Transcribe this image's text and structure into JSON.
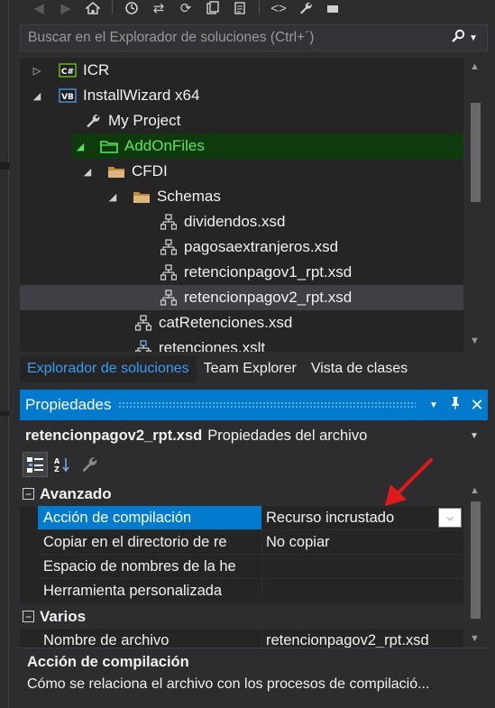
{
  "search": {
    "placeholder": "Buscar en el Explorador de soluciones (Ctrl+´)"
  },
  "tree": {
    "items": [
      {
        "label": "ICR",
        "icon": "csharp-project-icon",
        "expander": "collapsed"
      },
      {
        "label": "InstallWizard x64",
        "icon": "vb-project-icon",
        "expander": "expanded"
      },
      {
        "label": "My Project",
        "icon": "wrench-icon",
        "expander": "none"
      },
      {
        "label": "AddOnFiles",
        "icon": "folder-icon",
        "expander": "expanded"
      },
      {
        "label": "CFDI",
        "icon": "folder-icon",
        "expander": "expanded"
      },
      {
        "label": "Schemas",
        "icon": "folder-icon",
        "expander": "expanded"
      },
      {
        "label": "dividendos.xsd",
        "icon": "xsd-schema-icon",
        "expander": "none"
      },
      {
        "label": "pagosaextranjeros.xsd",
        "icon": "xsd-schema-icon",
        "expander": "none"
      },
      {
        "label": "retencionpagov1_rpt.xsd",
        "icon": "xsd-schema-icon",
        "expander": "none"
      },
      {
        "label": "retencionpagov2_rpt.xsd",
        "icon": "xsd-schema-icon",
        "expander": "none"
      },
      {
        "label": "catRetenciones.xsd",
        "icon": "xsd-schema-icon",
        "expander": "none"
      },
      {
        "label": "retenciones.xslt",
        "icon": "xslt-icon",
        "expander": "none"
      }
    ]
  },
  "tabs": [
    {
      "label": "Explorador de soluciones",
      "active": true
    },
    {
      "label": "Team Explorer",
      "active": false
    },
    {
      "label": "Vista de clases",
      "active": false
    }
  ],
  "properties": {
    "title": "Propiedades",
    "object_name": "retencionpagov2_rpt.xsd",
    "object_type": "Propiedades del archivo",
    "categories": [
      {
        "name": "Avanzado",
        "rows": [
          {
            "label": "Acción de compilación",
            "value": "Recurso incrustado"
          },
          {
            "label": "Copiar en el directorio de re",
            "value": "No copiar"
          },
          {
            "label": "Espacio de nombres de la he",
            "value": ""
          },
          {
            "label": "Herramienta personalizada",
            "value": ""
          }
        ]
      },
      {
        "name": "Varios",
        "rows": [
          {
            "label": "Nombre de archivo",
            "value": "retencionpagov2_rpt.xsd"
          }
        ]
      }
    ],
    "description": {
      "title": "Acción de compilación",
      "text": "Cómo se relaciona el archivo con los procesos de compilació..."
    }
  },
  "colors": {
    "accent": "#007acc",
    "active_tree_text": "#5ee35e",
    "annotation_arrow": "#e01a1a"
  }
}
